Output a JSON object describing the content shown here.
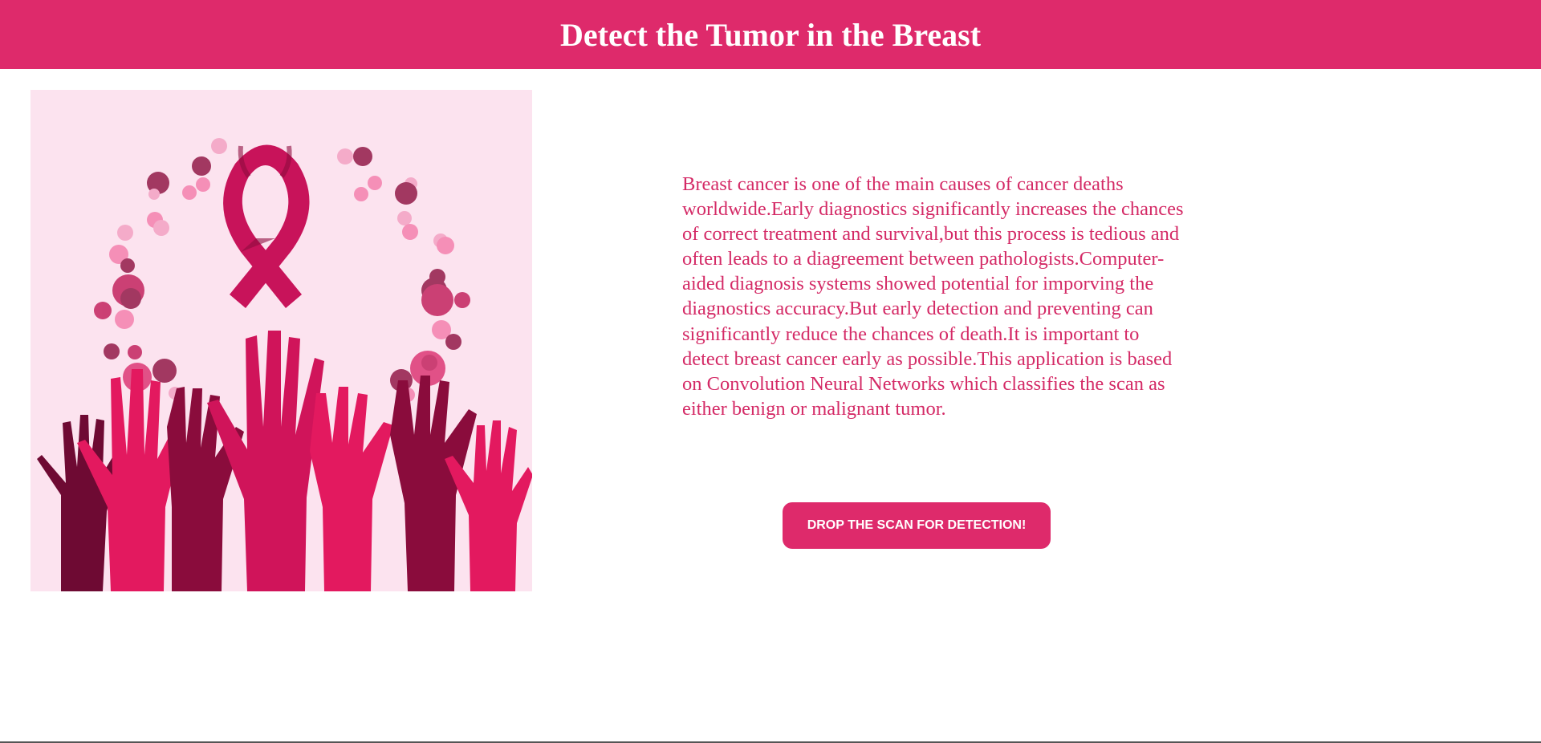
{
  "header": {
    "title": "Detect the Tumor in the Breast"
  },
  "illustration": {
    "icon": "breast-cancer-awareness-ribbon-hands"
  },
  "main": {
    "description": "Breast cancer is one of the main causes of cancer deaths worldwide.Early diagnostics significantly increases the chances of correct treatment and survival,but this process is tedious and often leads to a diagreement between pathologists.Computer-aided diagnosis systems showed potential for imporving the diagnostics accuracy.But early detection and preventing can significantly reduce the chances of death.It is important to detect breast cancer early as possible.This application is based on Convolution Neural Networks which classifies the scan as either benign or malignant tumor.",
    "cta_label": "DROP THE SCAN FOR DETECTION!"
  },
  "colors": {
    "accent": "#de2a6b",
    "text": "#d42a66",
    "illustration_bg": "#fce3ef"
  }
}
